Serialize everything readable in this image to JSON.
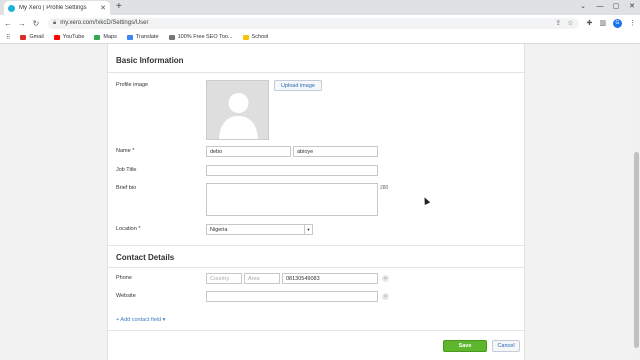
{
  "browser": {
    "tab_title": "My Xero | Profile Settings",
    "tab_close": "✕",
    "new_tab": "+",
    "url": "my.xero.com/!xkcD/Settings/User",
    "profile_initial": "G",
    "window_controls": {
      "minimize": "—",
      "maximize": "▢",
      "close": "✕"
    }
  },
  "bookmarks": [
    {
      "label": "Gmail",
      "color": "#d93025"
    },
    {
      "label": "YouTube",
      "color": "#ff0000"
    },
    {
      "label": "Maps",
      "color": "#34a853"
    },
    {
      "label": "Translate",
      "color": "#4285f4"
    },
    {
      "label": "100% Free SEO Too...",
      "color": "#777777"
    },
    {
      "label": "School",
      "color": "#f4c20d"
    }
  ],
  "basic_info": {
    "title": "Basic Information",
    "profile_image_label": "Profile image",
    "upload_button": "Upload image",
    "name_label": "Name *",
    "first_name": "debo",
    "last_name": "abioye",
    "job_title_label": "Job Title",
    "job_title_value": "",
    "brief_bio_label": "Brief bio",
    "brief_bio_value": "",
    "bio_counter": "280",
    "location_label": "Location *",
    "location_value": "Nigeria"
  },
  "contact": {
    "title": "Contact Details",
    "phone_label": "Phone",
    "country_placeholder": "Country",
    "area_placeholder": "Area",
    "phone_number": "08130549083",
    "website_label": "Website",
    "website_value": "",
    "remove_glyph": "×",
    "add_field_link": "+ Add contact field ▾"
  },
  "actions": {
    "save": "Save",
    "cancel": "Cancel"
  },
  "colors": {
    "save_green": "#5db62c",
    "link_blue": "#3b7ac4"
  }
}
